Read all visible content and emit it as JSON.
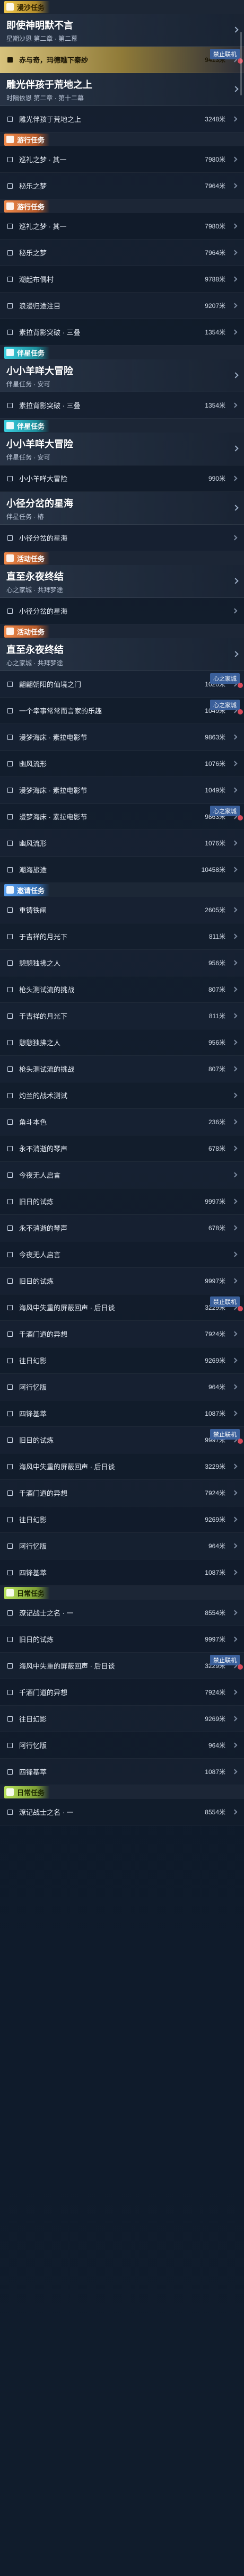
{
  "sections": [
    {
      "type": "sec",
      "color": "yellow",
      "label": "漫沙任务"
    },
    {
      "type": "head",
      "title": "即使神明默不言",
      "sub": "星期沙恩 第二章 · 第二幕"
    },
    {
      "type": "row",
      "active": true,
      "name": "赤与奇，玛德瞧下秦纱",
      "dist": "9413米",
      "badge": "禁止联机"
    },
    {
      "type": "head",
      "title": "雕光伴孩于荒地之上",
      "sub": "时隔依恩 第二章 · 第十二幕"
    },
    {
      "type": "row",
      "name": "雕光伴孩于荒地之上",
      "dist": "3248米"
    },
    {
      "type": "sec",
      "color": "orange",
      "label": "游行任务"
    },
    {
      "type": "row",
      "name": "巡礼之梦 · 其一",
      "dist": "7980米"
    },
    {
      "type": "row",
      "name": "秘乐之梦",
      "dist": "7964米"
    },
    {
      "type": "sec",
      "color": "orange",
      "label": "游行任务"
    },
    {
      "type": "row",
      "name": "巡礼之梦 · 其一",
      "dist": "7980米"
    },
    {
      "type": "row",
      "name": "秘乐之梦",
      "dist": "7964米"
    },
    {
      "type": "row",
      "name": "潮起布偶村",
      "dist": "9788米"
    },
    {
      "type": "row",
      "name": "浪漫归途注目",
      "dist": "9207米"
    },
    {
      "type": "row",
      "name": "素拉背影突破 · 三叠",
      "dist": "1354米"
    },
    {
      "type": "sec",
      "color": "cyan",
      "label": "伴星任务"
    },
    {
      "type": "head",
      "title": "小小羊咩大冒险",
      "sub": "伴星任务 · 安可"
    },
    {
      "type": "row",
      "name": "素拉背影突破 · 三叠",
      "dist": "1354米"
    },
    {
      "type": "sec",
      "color": "cyan",
      "label": "伴星任务"
    },
    {
      "type": "head",
      "title": "小小羊咩大冒险",
      "sub": "伴星任务 · 安可"
    },
    {
      "type": "row",
      "name": "小小羊咩大冒险",
      "dist": "990米"
    },
    {
      "type": "head",
      "title": "小径分岔的星海",
      "sub": "伴星任务 · 椿"
    },
    {
      "type": "row",
      "name": "小径分岔的星海",
      "dist": ""
    },
    {
      "type": "sec",
      "color": "orange",
      "label": "活动任务"
    },
    {
      "type": "head",
      "title": "直至永夜终结",
      "sub": "心之家城 · 共拜梦途"
    },
    {
      "type": "row",
      "name": "小径分岔的星海",
      "dist": ""
    },
    {
      "type": "sec",
      "color": "orange",
      "label": "活动任务"
    },
    {
      "type": "head",
      "title": "直至永夜终结",
      "sub": "心之家城 · 共拜梦途"
    },
    {
      "type": "row",
      "name": "翩翩朝阳的仙境之门",
      "dist": "1020米",
      "badge": "心之家城"
    },
    {
      "type": "row",
      "name": "一个幸事常常而言家的乐趣",
      "dist": "1049米",
      "badge": "心之家城"
    },
    {
      "type": "row",
      "name": "漫梦海床 · 素拉电影节",
      "dist": "9863米"
    },
    {
      "type": "row",
      "name": "幽风流形",
      "dist": "1076米"
    },
    {
      "type": "row",
      "name": "漫梦海床 · 素拉电影节",
      "dist": "1049米"
    },
    {
      "type": "row",
      "name": "漫梦海床 · 素拉电影节",
      "dist": "9863米",
      "badge": "心之家城"
    },
    {
      "type": "row",
      "name": "幽风流形",
      "dist": "1076米"
    },
    {
      "type": "row",
      "name": "潮海旅途",
      "dist": "10458米"
    },
    {
      "type": "sec",
      "color": "blue",
      "label": "邀请任务"
    },
    {
      "type": "row",
      "name": "重铸铁闸",
      "dist": "2605米"
    },
    {
      "type": "row",
      "name": "于吉祥的月光下",
      "dist": "811米"
    },
    {
      "type": "row",
      "name": "憩憩独拂之人",
      "dist": "956米"
    },
    {
      "type": "row",
      "name": "枪头测试流的挑战",
      "dist": "807米"
    },
    {
      "type": "row",
      "name": "于吉祥的月光下",
      "dist": "811米"
    },
    {
      "type": "row",
      "name": "憩憩独拂之人",
      "dist": "956米"
    },
    {
      "type": "row",
      "name": "枪头测试流的挑战",
      "dist": "807米"
    },
    {
      "type": "row",
      "name": "灼兰的战术测试",
      "dist": ""
    },
    {
      "type": "row",
      "name": "角斗本色",
      "dist": "236米"
    },
    {
      "type": "row",
      "name": "永不消逝的琴声",
      "dist": "678米"
    },
    {
      "type": "row",
      "name": "今夜无人启言",
      "dist": ""
    },
    {
      "type": "row",
      "name": "旧日的试炼",
      "dist": "9997米"
    },
    {
      "type": "row",
      "name": "永不消逝的琴声",
      "dist": "678米"
    },
    {
      "type": "row",
      "name": "今夜无人启言",
      "dist": ""
    },
    {
      "type": "row",
      "name": "旧日的试炼",
      "dist": "9997米"
    },
    {
      "type": "row",
      "name": "海风中失重的屏蔽回声 · 后日谈",
      "dist": "3229米",
      "badge": "禁止联机"
    },
    {
      "type": "row",
      "name": "千酒门道的异想",
      "dist": "7924米"
    },
    {
      "type": "row",
      "name": "往日幻影",
      "dist": "9269米"
    },
    {
      "type": "row",
      "name": "阿行忆版",
      "dist": "964米"
    },
    {
      "type": "row",
      "name": "四锋基萃",
      "dist": "1087米"
    },
    {
      "type": "row",
      "name": "旧日的试炼",
      "dist": "9997米",
      "badge": "禁止联机"
    },
    {
      "type": "row",
      "name": "海风中失重的屏蔽回声 · 后日谈",
      "dist": "3229米"
    },
    {
      "type": "row",
      "name": "千酒门道的异想",
      "dist": "7924米"
    },
    {
      "type": "row",
      "name": "往日幻影",
      "dist": "9269米"
    },
    {
      "type": "row",
      "name": "阿行忆版",
      "dist": "964米"
    },
    {
      "type": "row",
      "name": "四锋基萃",
      "dist": "1087米"
    },
    {
      "type": "sec",
      "color": "green",
      "label": "日常任务"
    },
    {
      "type": "row",
      "name": "潦记战士之名 · 一",
      "dist": "8554米"
    },
    {
      "type": "row",
      "name": "旧日的试炼",
      "dist": "9997米"
    },
    {
      "type": "row",
      "name": "海风中失重的屏蔽回声 · 后日谈",
      "dist": "3229米",
      "badge": "禁止联机"
    },
    {
      "type": "row",
      "name": "千酒门道的异想",
      "dist": "7924米"
    },
    {
      "type": "row",
      "name": "往日幻影",
      "dist": "9269米"
    },
    {
      "type": "row",
      "name": "阿行忆版",
      "dist": "964米"
    },
    {
      "type": "row",
      "name": "四锋基萃",
      "dist": "1087米"
    },
    {
      "type": "sec",
      "color": "green",
      "label": "日常任务"
    },
    {
      "type": "row",
      "name": "潦记战士之名 · 一",
      "dist": "8554米"
    }
  ]
}
